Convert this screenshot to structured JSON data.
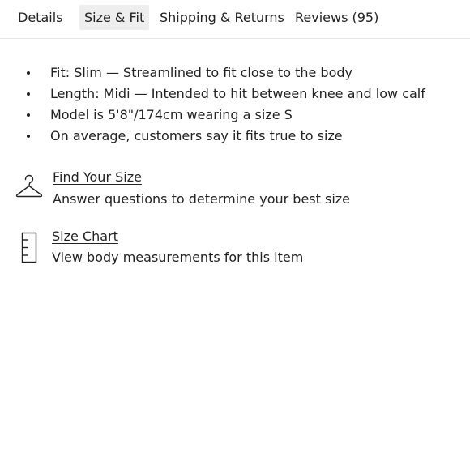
{
  "tabs": [
    {
      "label": "Details",
      "active": false
    },
    {
      "label": "Size & Fit",
      "active": true
    },
    {
      "label": "Shipping & Returns",
      "active": false
    },
    {
      "label": "Reviews (95)",
      "active": false
    }
  ],
  "fit_details": [
    "Fit: Slim — Streamlined to fit close to the body",
    "Length: Midi — Intended to hit between knee and low calf",
    "Model is 5'8\"/174cm wearing a size S",
    "On average, customers say it fits true to size"
  ],
  "find_size": {
    "icon": "hanger-icon",
    "link": "Find Your Size",
    "description": "Answer questions to determine your best size"
  },
  "size_chart": {
    "icon": "ruler-icon",
    "link": "Size Chart",
    "description": "View body measurements for this item"
  },
  "colors": {
    "text": "#222222",
    "active_tab_bg": "#eeeeee",
    "divider": "#e6e6e6"
  }
}
